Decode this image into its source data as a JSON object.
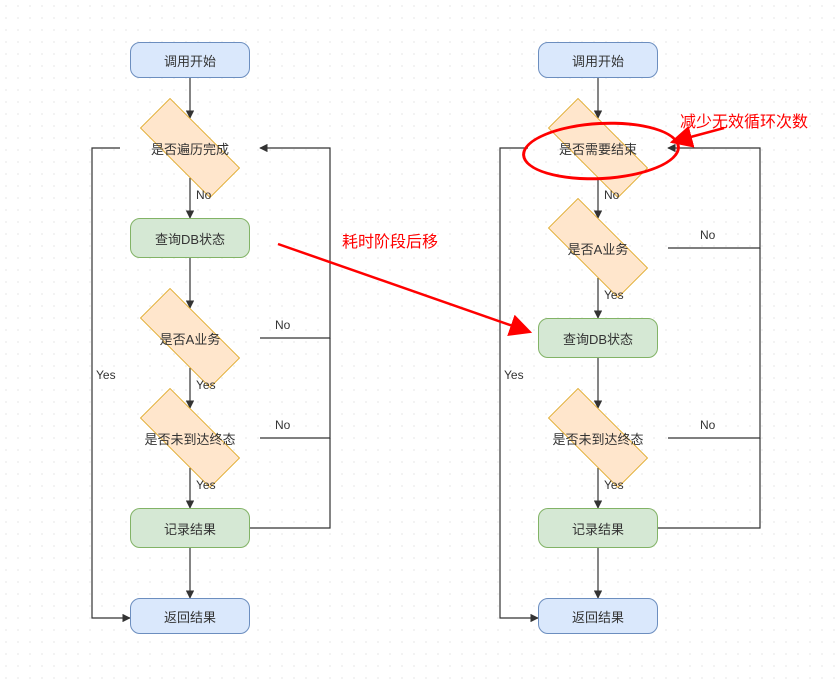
{
  "left": {
    "start": "调用开始",
    "dec1": "是否遍历完成",
    "proc1": "查询DB状态",
    "dec2": "是否A业务",
    "dec3": "是否未到达终态",
    "proc2": "记录结果",
    "ret": "返回结果"
  },
  "right": {
    "start": "调用开始",
    "dec1": "是否需要结束",
    "dec2": "是否A业务",
    "proc1": "查询DB状态",
    "dec3": "是否未到达终态",
    "proc2": "记录结果",
    "ret": "返回结果"
  },
  "labels": {
    "yes": "Yes",
    "no": "No"
  },
  "annot": {
    "reduce": "减少无效循环次数",
    "delay": "耗时阶段后移"
  }
}
